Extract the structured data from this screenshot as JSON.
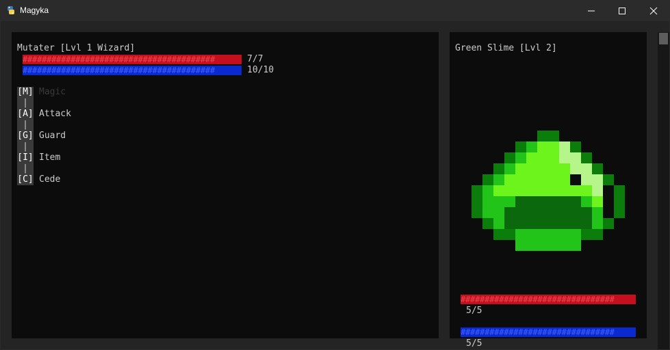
{
  "window": {
    "title": "Magyka",
    "icons": {
      "app": "python-icon",
      "minimize": "minimize-icon",
      "maximize": "maximize-icon",
      "close": "close-icon"
    }
  },
  "colors": {
    "hp_bar": "#c50f1f",
    "mp_bar": "#0a2ad0",
    "console_bg": "#0c0c0c",
    "text": "#cccccc",
    "disabled_text": "#3a3a3a",
    "slime_outline": "#0b7d0b",
    "slime_body": "#22c41a",
    "slime_bright": "#6cf41c",
    "slime_highlight": "#b6f58a",
    "slime_shadow": "#0c680c"
  },
  "player": {
    "name_line": "Mutater [Lvl 1 Wizard]",
    "hp_bar": "########################################",
    "hp_text": "7/7",
    "hp_fraction": 1,
    "mp_bar": "########################################",
    "mp_text": "10/10",
    "mp_fraction": 1
  },
  "menu": {
    "connector": "|",
    "items": [
      {
        "key": "[M]",
        "label": "Magic",
        "enabled": false
      },
      {
        "key": "[A]",
        "label": "Attack",
        "enabled": true
      },
      {
        "key": "[G]",
        "label": "Guard",
        "enabled": true
      },
      {
        "key": "[I]",
        "label": "Item",
        "enabled": true
      },
      {
        "key": "[C]",
        "label": "Cede",
        "enabled": true
      }
    ]
  },
  "enemy": {
    "name_line": "Green Slime [Lvl 2]",
    "sprite": "green-slime-sprite",
    "hp_bar": "################################",
    "hp_text": "5/5",
    "hp_fraction": 1,
    "mp_bar": "################################",
    "mp_text": "5/5",
    "mp_fraction": 1
  }
}
